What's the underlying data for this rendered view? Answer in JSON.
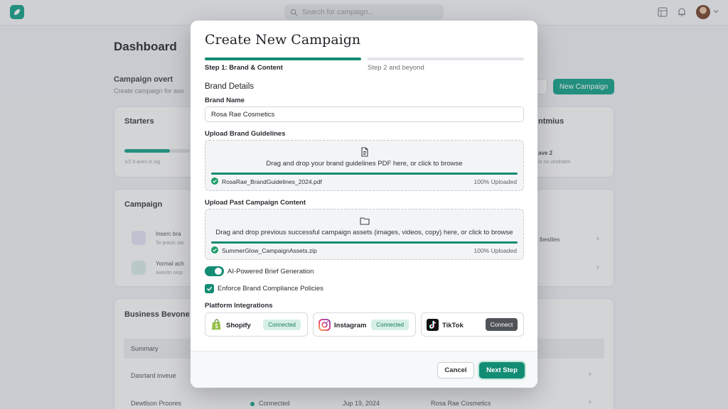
{
  "background": {
    "search_placeholder": "Search for campaign...",
    "dashboard_title": "Dashboard",
    "campaign_section_title": "Campaign overt",
    "campaign_section_sub": "Create campaign for avo",
    "new_campaign_label": "New Campaign",
    "starters_title": "Starters",
    "starters_note": "1/2 it  aves in sig",
    "right_card_title": "ntmius",
    "right_card_line1": "ave 2",
    "right_card_line2": "in no vindratim",
    "campaign_card_title": "Campaign",
    "row1_title": "Inserc bra",
    "row1_sub": "To pracic sta",
    "row2_title": "Yormal ach",
    "row2_sub": "Avecitn oisp",
    "row_right_text": "lbesllies",
    "business_title": "Business Bevone",
    "table_summary": "Summary",
    "table_row1_col1": "Dasrtard inveue",
    "table_row2_col1": "Dewtlson Proores",
    "table_row2_col2": "Connected",
    "table_row2_col3": "Jup 19, 2024",
    "table_row2_col4": "Rosa Rae Cosmetics"
  },
  "modal": {
    "title": "Create New Campaign",
    "steps": [
      {
        "label": "Step 1: Brand & Content",
        "active": true
      },
      {
        "label": "Step 2 and beyond",
        "active": false
      }
    ],
    "section_title": "Brand Details",
    "brand_name_label": "Brand Name",
    "brand_name_value": "Rosa Rae Cosmetics",
    "guidelines": {
      "label": "Upload Brand Guidelines",
      "icon": "document-icon",
      "prompt": "Drag and drop your brand guidelines PDF here, or click to browse",
      "file_name": "RosaRae_BrandGuidelines_2024.pdf",
      "status": "100% Uploaded",
      "progress": 1.0
    },
    "past_content": {
      "label": "Upload Past Campaign Content",
      "icon": "folder-icon",
      "prompt": "Drag and drop previous successful campaign assets (images, videos, copy) here, or click to browse",
      "file_name": "SummerGlow_CampaignAssets.zip",
      "status": "100% Uploaded",
      "progress": 1.0
    },
    "ai_toggle": {
      "label": "AI-Powered Brief Generation",
      "enabled": true
    },
    "compliance_checkbox": {
      "label": "Enforce Brand Compliance Policies",
      "checked": true
    },
    "platforms_title": "Platform Integrations",
    "platforms": [
      {
        "name": "Shopify",
        "status": "Connected",
        "icon": "shopify-icon"
      },
      {
        "name": "Instagram",
        "status": "Connected",
        "icon": "instagram-icon"
      },
      {
        "name": "TikTok",
        "action": "Connect",
        "icon": "tiktok-icon"
      }
    ],
    "cancel_label": "Cancel",
    "next_label": "Next Step"
  },
  "colors": {
    "accent": "#138c74",
    "accent_light": "#1aa58c",
    "badge_bg": "#d5efe6",
    "badge_text": "#1a7a62",
    "connect_button": "#505458"
  }
}
